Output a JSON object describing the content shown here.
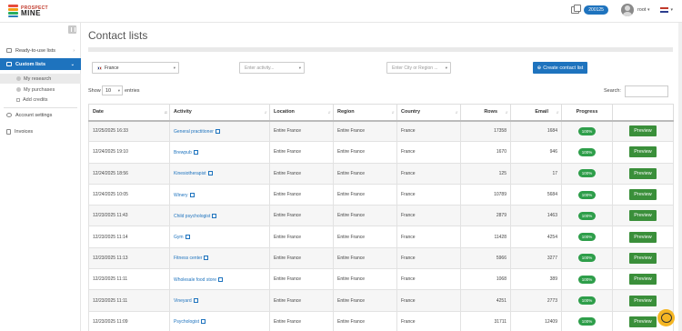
{
  "header": {
    "logo_top": "PROSPECT",
    "logo_bottom": "MINE",
    "credits": "200125",
    "user": "root"
  },
  "sidebar": {
    "items": [
      {
        "label": "Ready-to-use lists"
      },
      {
        "label": "Custom lists"
      },
      {
        "label": "My research"
      },
      {
        "label": "My purchases"
      },
      {
        "label": "Add credits"
      },
      {
        "label": "Account settings"
      },
      {
        "label": "Invoices"
      }
    ]
  },
  "main": {
    "title": "Contact lists",
    "filters": {
      "country": "France",
      "activity_placeholder": "Enter activity...",
      "city_placeholder": "Enter City or Region ..."
    },
    "create_button": "Create contact list",
    "show_label": "Show",
    "entries_value": "10",
    "entries_label": "entries",
    "search_label": "Search:",
    "columns": [
      "Date",
      "Activity",
      "Location",
      "Region",
      "Country",
      "Rows",
      "Email",
      "Progress",
      ""
    ],
    "rows": [
      {
        "date": "12/25/2025 16:33",
        "activity": "General practitioner",
        "location": "Entire France",
        "region": "Entire France",
        "country": "France",
        "rows": "17358",
        "email": "1684",
        "progress": "100%",
        "action": "Preview"
      },
      {
        "date": "12/24/2025 19:10",
        "activity": "Brewpub",
        "location": "Entire France",
        "region": "Entire France",
        "country": "France",
        "rows": "1670",
        "email": "946",
        "progress": "100%",
        "action": "Preview"
      },
      {
        "date": "12/24/2025 18:56",
        "activity": "Kinesiotherapist",
        "location": "Entire France",
        "region": "Entire France",
        "country": "France",
        "rows": "125",
        "email": "17",
        "progress": "100%",
        "action": "Preview"
      },
      {
        "date": "12/24/2025 10:05",
        "activity": "Winery",
        "location": "Entire France",
        "region": "Entire France",
        "country": "France",
        "rows": "10789",
        "email": "5684",
        "progress": "100%",
        "action": "Preview"
      },
      {
        "date": "12/23/2025 11:43",
        "activity": "Child psychologist",
        "location": "Entire France",
        "region": "Entire France",
        "country": "France",
        "rows": "2879",
        "email": "1463",
        "progress": "100%",
        "action": "Preview"
      },
      {
        "date": "12/23/2025 11:14",
        "activity": "Gym",
        "location": "Entire France",
        "region": "Entire France",
        "country": "France",
        "rows": "11428",
        "email": "4254",
        "progress": "100%",
        "action": "Preview"
      },
      {
        "date": "12/23/2025 11:13",
        "activity": "Fitness center",
        "location": "Entire France",
        "region": "Entire France",
        "country": "France",
        "rows": "5966",
        "email": "3277",
        "progress": "100%",
        "action": "Preview"
      },
      {
        "date": "12/23/2025 11:11",
        "activity": "Wholesale food store",
        "location": "Entire France",
        "region": "Entire France",
        "country": "France",
        "rows": "1068",
        "email": "389",
        "progress": "100%",
        "action": "Preview"
      },
      {
        "date": "12/23/2025 11:11",
        "activity": "Vineyard",
        "location": "Entire France",
        "region": "Entire France",
        "country": "France",
        "rows": "4251",
        "email": "2773",
        "progress": "100%",
        "action": "Preview"
      },
      {
        "date": "12/23/2025 11:09",
        "activity": "Psychologist",
        "location": "Entire France",
        "region": "Entire France",
        "country": "France",
        "rows": "31711",
        "email": "12409",
        "progress": "100%",
        "action": "Preview"
      }
    ]
  },
  "colors": {
    "primary": "#1e73be",
    "success": "#2e9e4a",
    "preview": "#3a8f3a",
    "logo_red": "#c0392b",
    "help": "#f5b623"
  }
}
